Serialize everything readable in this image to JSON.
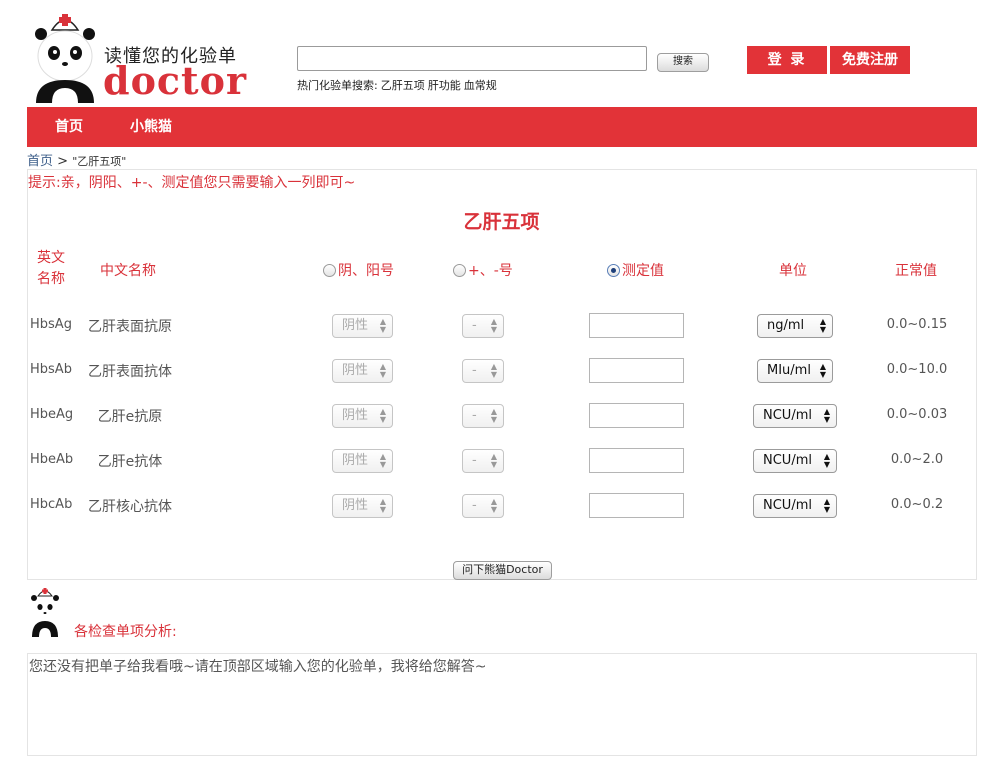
{
  "header": {
    "slogan": "读懂您的化验单",
    "brand": "doctor",
    "search": {
      "value": "",
      "placeholder": "",
      "button": "搜索"
    },
    "hot": {
      "label": "热门化验单搜索:",
      "items": [
        "乙肝五项",
        "肝功能",
        "血常规"
      ]
    },
    "login": "登 录",
    "register": "免费注册"
  },
  "nav": {
    "items": [
      "首页",
      "小熊猫"
    ]
  },
  "breadcrumb": {
    "home": "首页",
    "sep": ">",
    "current": "\"乙肝五项\""
  },
  "form": {
    "tip": "提示:亲，阴阳、+-、测定值您只需要输入一列即可~",
    "title": "乙肝五项",
    "headers": {
      "english_line1": "英文",
      "english_line2": "名称",
      "chinese": "中文名称",
      "posneg": "阴、阳号",
      "plusminus": "+、-号",
      "measured": "测定值",
      "unit": "单位",
      "normal": "正常值"
    },
    "selected_mode": "测定值",
    "rows": [
      {
        "en": "HbsAg",
        "cn": "乙肝表面抗原",
        "posneg": "阴性",
        "plusminus": "-",
        "measured": "",
        "unit": "ng/ml",
        "normal": "0.0~0.15"
      },
      {
        "en": "HbsAb",
        "cn": "乙肝表面抗体",
        "posneg": "阴性",
        "plusminus": "-",
        "measured": "",
        "unit": "MIu/ml",
        "normal": "0.0~10.0"
      },
      {
        "en": "HbeAg",
        "cn": "乙肝e抗原",
        "posneg": "阴性",
        "plusminus": "-",
        "measured": "",
        "unit": "NCU/ml",
        "normal": "0.0~0.03"
      },
      {
        "en": "HbeAb",
        "cn": "乙肝e抗体",
        "posneg": "阴性",
        "plusminus": "-",
        "measured": "",
        "unit": "NCU/ml",
        "normal": "0.0~2.0"
      },
      {
        "en": "HbcAb",
        "cn": "乙肝核心抗体",
        "posneg": "阴性",
        "plusminus": "-",
        "measured": "",
        "unit": "NCU/ml",
        "normal": "0.0~0.2"
      }
    ],
    "submit": "问下熊猫Doctor"
  },
  "analysis": {
    "title": "各检查单项分析:",
    "message": "您还没有把单子给我看哦~请在顶部区域输入您的化验单，我将给您解答~"
  },
  "colors": {
    "accent": "#e23338",
    "link": "#3e5f8a"
  }
}
